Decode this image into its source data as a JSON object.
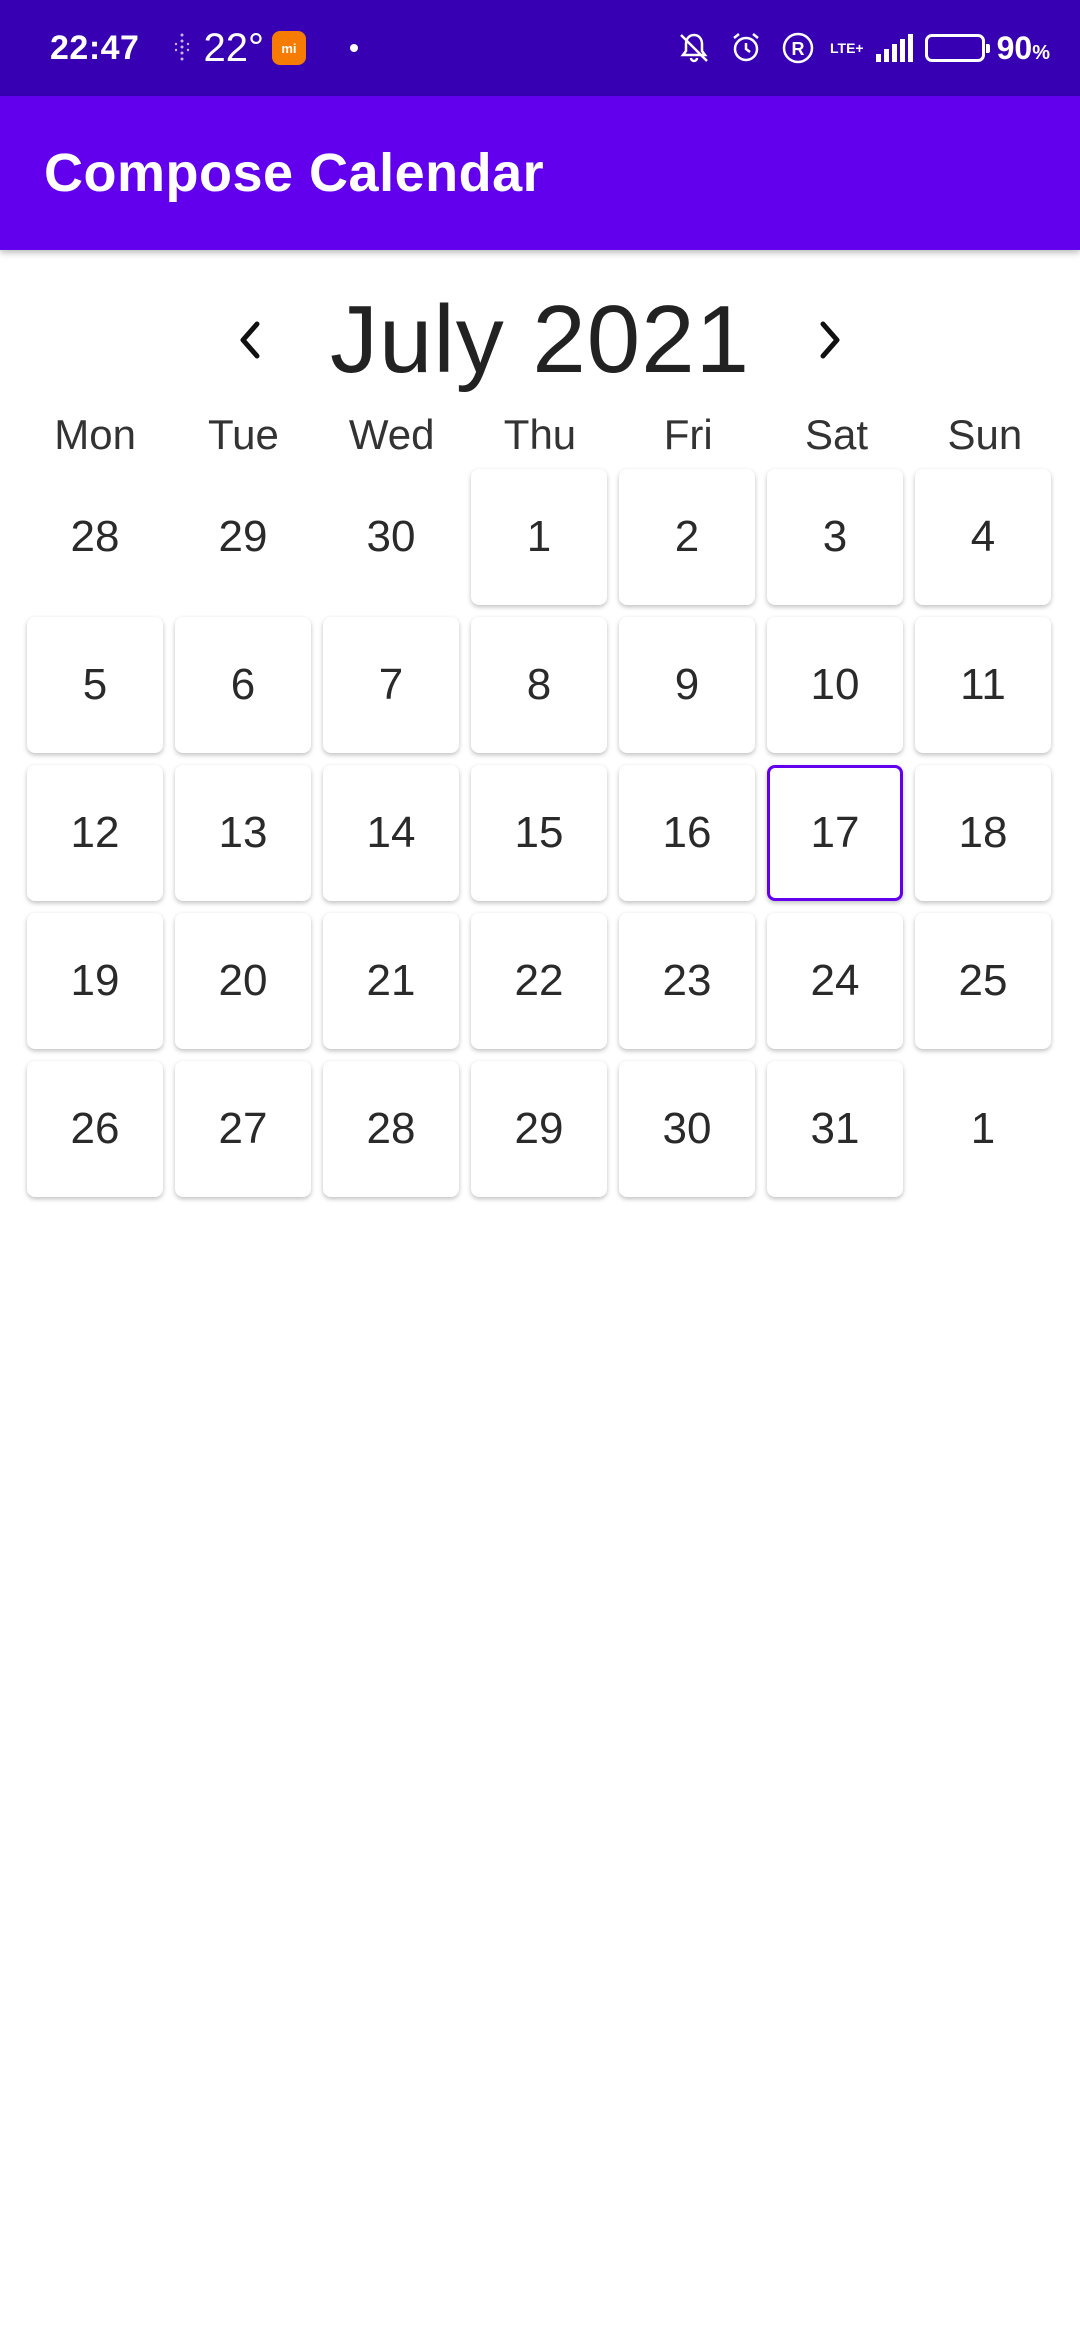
{
  "status_bar": {
    "time": "22:47",
    "temperature": "22°",
    "mi_badge": "mi",
    "network": "LTE+",
    "battery_percent": "90",
    "battery_unit": "%",
    "battery_level": 0.9,
    "icons": [
      "weather-icon",
      "mi-app-icon",
      "notification-dot-icon",
      "mute-icon",
      "alarm-icon",
      "roaming-icon",
      "signal-icon",
      "battery-icon"
    ]
  },
  "app_bar": {
    "title": "Compose Calendar",
    "color": "#6200ee"
  },
  "calendar": {
    "month_title": "July 2021",
    "prev_icon": "chevron-left-icon",
    "next_icon": "chevron-right-icon",
    "weekdays": [
      "Mon",
      "Tue",
      "Wed",
      "Thu",
      "Fri",
      "Sat",
      "Sun"
    ],
    "selected_day": "17",
    "accent_color": "#6200ee",
    "days": [
      {
        "label": "28",
        "in_month": false
      },
      {
        "label": "29",
        "in_month": false
      },
      {
        "label": "30",
        "in_month": false
      },
      {
        "label": "1",
        "in_month": true
      },
      {
        "label": "2",
        "in_month": true
      },
      {
        "label": "3",
        "in_month": true
      },
      {
        "label": "4",
        "in_month": true
      },
      {
        "label": "5",
        "in_month": true
      },
      {
        "label": "6",
        "in_month": true
      },
      {
        "label": "7",
        "in_month": true
      },
      {
        "label": "8",
        "in_month": true
      },
      {
        "label": "9",
        "in_month": true
      },
      {
        "label": "10",
        "in_month": true
      },
      {
        "label": "11",
        "in_month": true
      },
      {
        "label": "12",
        "in_month": true
      },
      {
        "label": "13",
        "in_month": true
      },
      {
        "label": "14",
        "in_month": true
      },
      {
        "label": "15",
        "in_month": true
      },
      {
        "label": "16",
        "in_month": true
      },
      {
        "label": "17",
        "in_month": true,
        "selected": true
      },
      {
        "label": "18",
        "in_month": true
      },
      {
        "label": "19",
        "in_month": true
      },
      {
        "label": "20",
        "in_month": true
      },
      {
        "label": "21",
        "in_month": true
      },
      {
        "label": "22",
        "in_month": true
      },
      {
        "label": "23",
        "in_month": true
      },
      {
        "label": "24",
        "in_month": true
      },
      {
        "label": "25",
        "in_month": true
      },
      {
        "label": "26",
        "in_month": true
      },
      {
        "label": "27",
        "in_month": true
      },
      {
        "label": "28",
        "in_month": true
      },
      {
        "label": "29",
        "in_month": true
      },
      {
        "label": "30",
        "in_month": true
      },
      {
        "label": "31",
        "in_month": true
      },
      {
        "label": "1",
        "in_month": false
      }
    ]
  }
}
